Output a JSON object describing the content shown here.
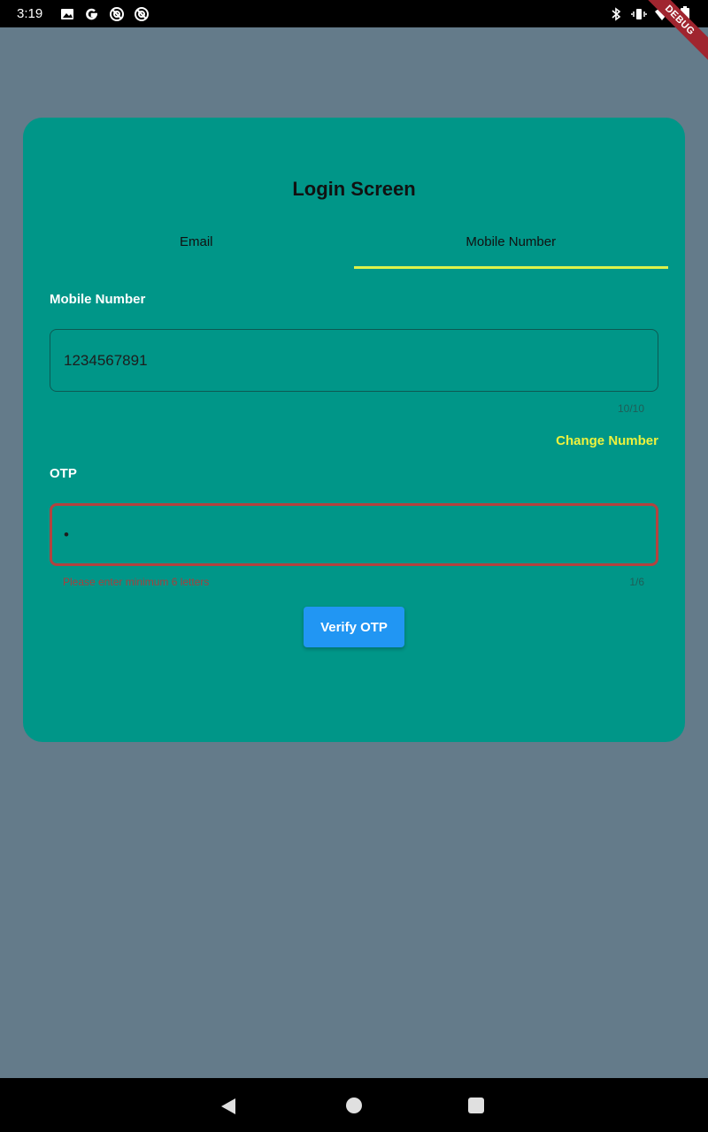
{
  "status_bar": {
    "time": "3:19",
    "left_icons": [
      "image-icon",
      "google-icon",
      "at-sign-icon",
      "at-sign-icon"
    ],
    "right_icons": [
      "bluetooth-icon",
      "vibrate-icon",
      "wifi-icon",
      "battery-icon"
    ]
  },
  "debug_banner": {
    "label": "DEBUG"
  },
  "card": {
    "title": "Login Screen",
    "tabs": [
      {
        "label": "Email",
        "active": false
      },
      {
        "label": "Mobile Number",
        "active": true
      }
    ],
    "mobile": {
      "label": "Mobile Number",
      "value": "1234567891",
      "counter": "10/10"
    },
    "change_number_label": "Change Number",
    "otp": {
      "label": "OTP",
      "value": "•",
      "counter": "1/6",
      "error": "Please enter minimum 6 letters"
    },
    "verify_label": "Verify OTP"
  },
  "colors": {
    "background": "#647b8a",
    "card": "#009688",
    "tab_indicator": "#ddf34a",
    "link": "#eef23d",
    "error": "#b3423f",
    "button": "#2196f3"
  },
  "nav_bar": {
    "buttons": [
      "back-icon",
      "home-icon",
      "recents-icon"
    ]
  }
}
